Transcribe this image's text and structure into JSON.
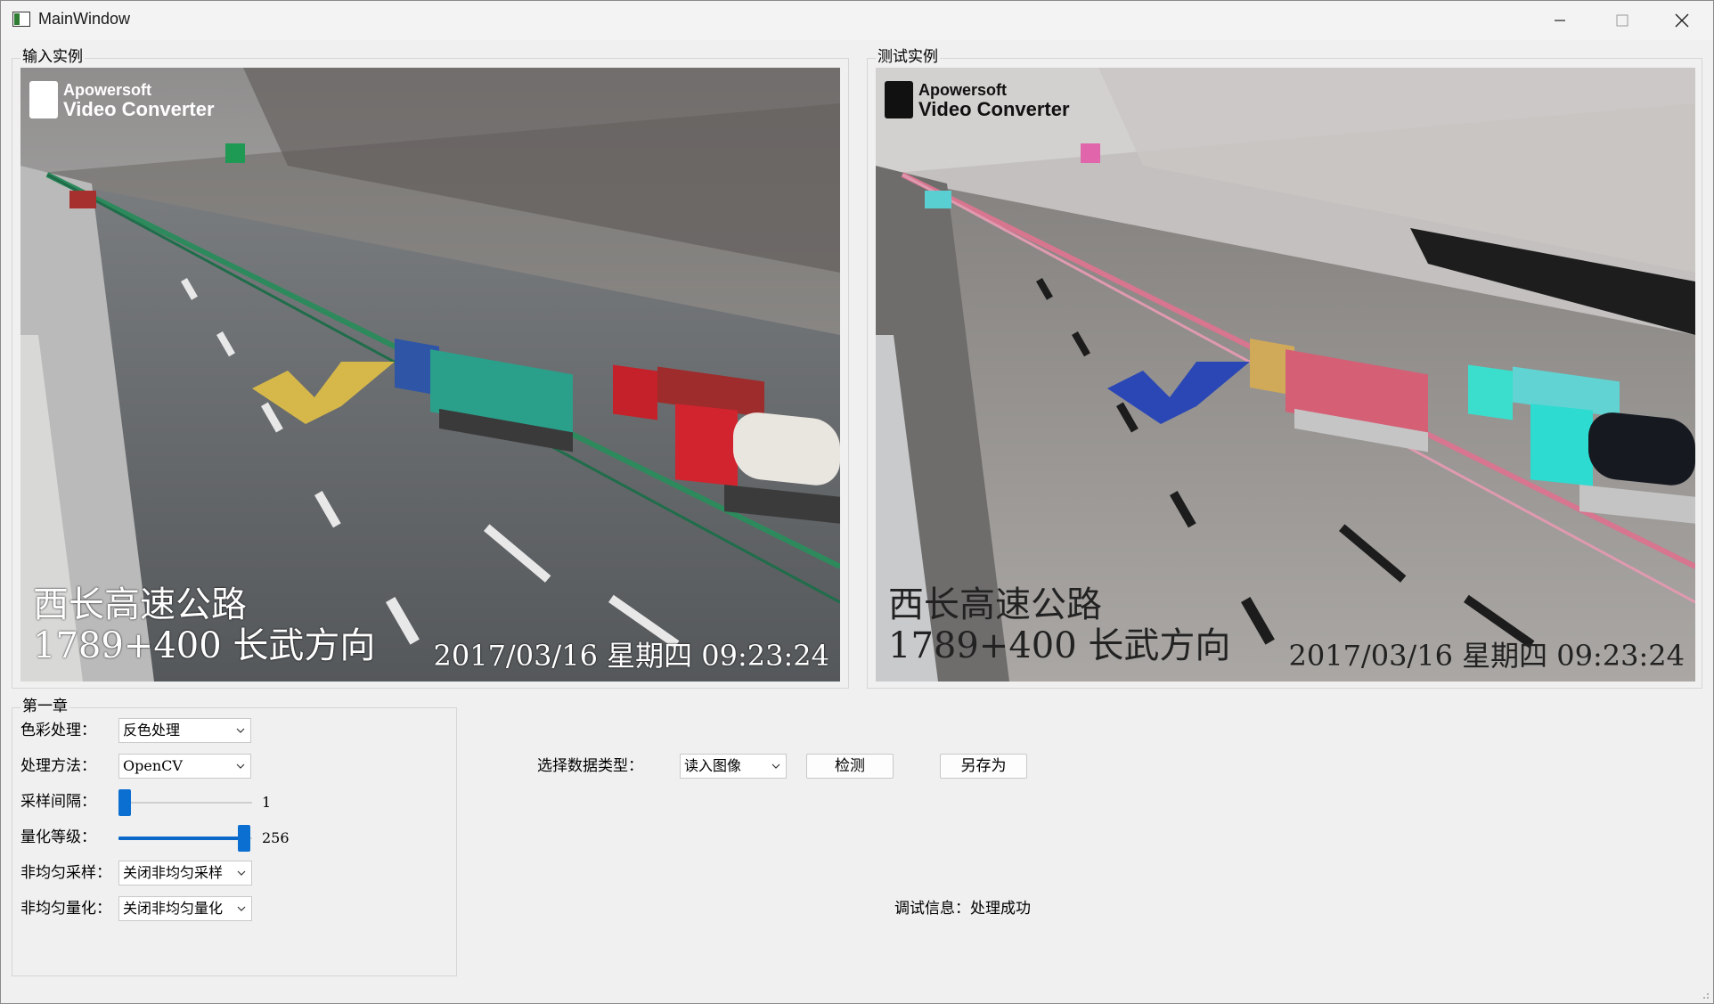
{
  "window": {
    "title": "MainWindow"
  },
  "input_group": {
    "title": "输入实例",
    "overlay": {
      "logo_line1": "Apowersoft",
      "logo_line2": "Video Converter",
      "road_line1": "西长高速公路",
      "road_line2": "1789+400 长武方向",
      "timestamp": "2017/03/16 星期四 09:23:24"
    }
  },
  "test_group": {
    "title": "测试实例",
    "overlay": {
      "logo_line1": "Apowersoft",
      "logo_line2": "Video Converter",
      "road_line1": "西长高速公路",
      "road_line2": "1789+400 长武方向",
      "timestamp": "2017/03/16 星期四 09:23:24"
    }
  },
  "chapter_group": {
    "title": "第一章",
    "color_processing": {
      "label": "色彩处理：",
      "value": "反色处理"
    },
    "method": {
      "label": "处理方法：",
      "value": "OpenCV"
    },
    "sampling": {
      "label": "采样间隔：",
      "value": "1",
      "fraction": 0.0
    },
    "quant": {
      "label": "量化等级：",
      "value": "256",
      "fraction": 1.0
    },
    "nonuniform_sampling": {
      "label": "非均匀采样：",
      "value": "关闭非均匀采样"
    },
    "nonuniform_quant": {
      "label": "非均匀量化：",
      "value": "关闭非均匀量化"
    }
  },
  "controls": {
    "data_type_label": "选择数据类型：",
    "data_type_value": "读入图像",
    "detect_button": "检测",
    "save_as_button": "另存为",
    "debug_label": "调试信息：",
    "debug_value": "处理成功"
  },
  "colors": {
    "accent": "#0b6fd1"
  }
}
